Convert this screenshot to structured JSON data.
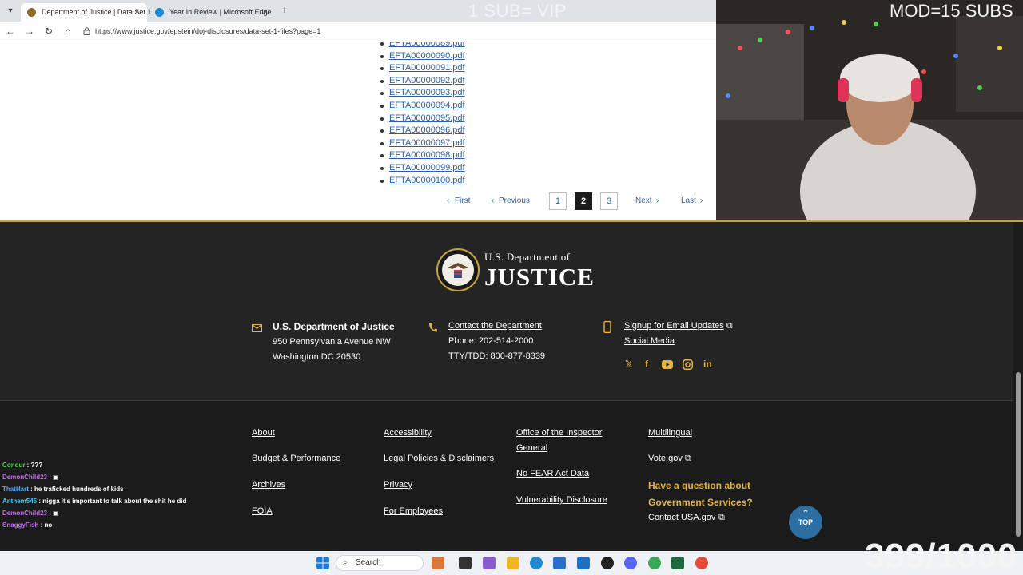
{
  "browser": {
    "tabs": [
      {
        "label": "Department of Justice | Data Set 1",
        "active": true
      },
      {
        "label": "Year In Review | Microsoft Edge",
        "active": false
      }
    ],
    "url": "https://www.justice.gov/epstein/doj-disclosures/data-set-1-files?page=1"
  },
  "overlay": {
    "sub_text": "1 SUB= VIP",
    "mod_text": "MOD=15 SUBS",
    "counter": "399/1000"
  },
  "files": [
    "EFTA00000090.pdf",
    "EFTA00000091.pdf",
    "EFTA00000092.pdf",
    "EFTA00000093.pdf",
    "EFTA00000094.pdf",
    "EFTA00000095.pdf",
    "EFTA00000096.pdf",
    "EFTA00000097.pdf",
    "EFTA00000098.pdf",
    "EFTA00000099.pdf",
    "EFTA00000100.pdf"
  ],
  "pagination": {
    "first": "First",
    "previous": "Previous",
    "next": "Next",
    "last": "Last",
    "pages": [
      "1",
      "2",
      "3"
    ],
    "current": "2"
  },
  "footer": {
    "logo_line1": "U.S. Department of",
    "logo_line2": "JUSTICE",
    "address_title": "U.S. Department of Justice",
    "address_line1": "950 Pennsylvania Avenue NW",
    "address_line2": "Washington DC 20530",
    "contact_link": "Contact the Department",
    "phone": "Phone: 202-514-2000",
    "tty": "TTY/TDD: 800-877-8339",
    "email_updates": "Signup for Email Updates",
    "social_media": "Social Media",
    "links": {
      "col1": [
        "About",
        "Budget & Performance",
        "Archives",
        "FOIA"
      ],
      "col2": [
        "Accessibility",
        "Legal Policies & Disclaimers",
        "Privacy",
        "For Employees"
      ],
      "col3": [
        "Office of the Inspector General",
        "No FEAR Act Data",
        "Vulnerability Disclosure"
      ],
      "col4": [
        "Multilingual",
        "Vote.gov"
      ]
    },
    "question_line1": "Have a question about",
    "question_line2": "Government Services?",
    "contact_usa": "Contact USA.gov",
    "top_label": "TOP"
  },
  "chat": [
    {
      "name": "Conour",
      "color": "#4fd14f",
      "msg": "???"
    },
    {
      "name": "DemonChild23",
      "color": "#c46cf0",
      "msg": "▣"
    },
    {
      "name": "ThatHart",
      "color": "#4aa8ff",
      "msg": "he traficked hundreds of kids"
    },
    {
      "name": "Anthem545",
      "color": "#4fc6f0",
      "msg": "nigga it's important to talk about the shit he did"
    },
    {
      "name": "DemonChild23",
      "color": "#c46cf0",
      "msg": "▣"
    },
    {
      "name": "SnaggyFish",
      "color": "#c46cf0",
      "msg": "no"
    }
  ],
  "taskbar": {
    "search_placeholder": "Search"
  },
  "colors": {
    "footer_bg": "#242424",
    "accent_gold": "#e3b43e",
    "link_blue": "#2b5fa8",
    "top_button": "#2d6fa3"
  }
}
